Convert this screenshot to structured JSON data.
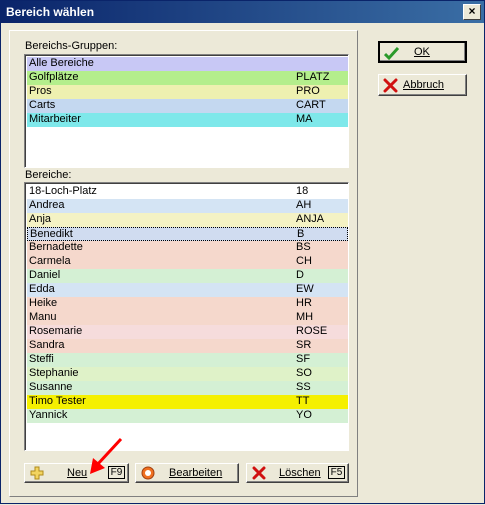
{
  "window": {
    "title": "Bereich wählen",
    "close_glyph": "×"
  },
  "groups": {
    "label": "Bereichs-Gruppen:",
    "items": [
      {
        "name": "Alle Bereiche",
        "code": "",
        "color": "#c8c8f5"
      },
      {
        "name": "Golfplätze",
        "code": "PLATZ",
        "color": "#b4ee8c"
      },
      {
        "name": "Pros",
        "code": "PRO",
        "color": "#eef0b0"
      },
      {
        "name": "Carts",
        "code": "CART",
        "color": "#c4d8f0"
      },
      {
        "name": "Mitarbeiter",
        "code": "MA",
        "color": "#7ee8ea"
      }
    ]
  },
  "areas": {
    "label": "Bereiche:",
    "items": [
      {
        "name": "18-Loch-Platz",
        "code": "18",
        "color": "#ffffff"
      },
      {
        "name": "Andrea",
        "code": "AH",
        "color": "#d4e4f4"
      },
      {
        "name": "Anja",
        "code": "ANJA",
        "color": "#f4f2c4"
      },
      {
        "name": "Benedikt",
        "code": "B",
        "color": "#d0dcf0",
        "selected": true
      },
      {
        "name": "Bernadette",
        "code": "BS",
        "color": "#f5d8cc"
      },
      {
        "name": "Carmela",
        "code": "CH",
        "color": "#f5d8cc"
      },
      {
        "name": "Daniel",
        "code": "D",
        "color": "#d4f0d4"
      },
      {
        "name": "Edda",
        "code": "EW",
        "color": "#d4e4f4"
      },
      {
        "name": "Heike",
        "code": "HR",
        "color": "#f5d8cc"
      },
      {
        "name": "Manu",
        "code": "MH",
        "color": "#f5d8cc"
      },
      {
        "name": "Rosemarie",
        "code": "ROSE",
        "color": "#f6dcdc"
      },
      {
        "name": "Sandra",
        "code": "SR",
        "color": "#f5d8cc"
      },
      {
        "name": "Steffi",
        "code": "SF",
        "color": "#d4f0d4"
      },
      {
        "name": "Stephanie",
        "code": "SO",
        "color": "#dff2c8"
      },
      {
        "name": "Susanne",
        "code": "SS",
        "color": "#d4f0d4"
      },
      {
        "name": "Timo Tester",
        "code": "TT",
        "color": "#f5f000"
      },
      {
        "name": "Yannick",
        "code": "YO",
        "color": "#d4f0d4"
      }
    ]
  },
  "buttons": {
    "new": {
      "label": "Neu",
      "key": "F9"
    },
    "edit": {
      "label": "Bearbeiten"
    },
    "delete": {
      "label": "Löschen",
      "key": "F5"
    },
    "ok": {
      "label": "OK"
    },
    "cancel": {
      "label": "Abbruch"
    }
  },
  "colors": {
    "title_start": "#0a246a",
    "title_end": "#3a6ea5",
    "face": "#ece9d8",
    "annotation_arrow": "#ff0000"
  }
}
